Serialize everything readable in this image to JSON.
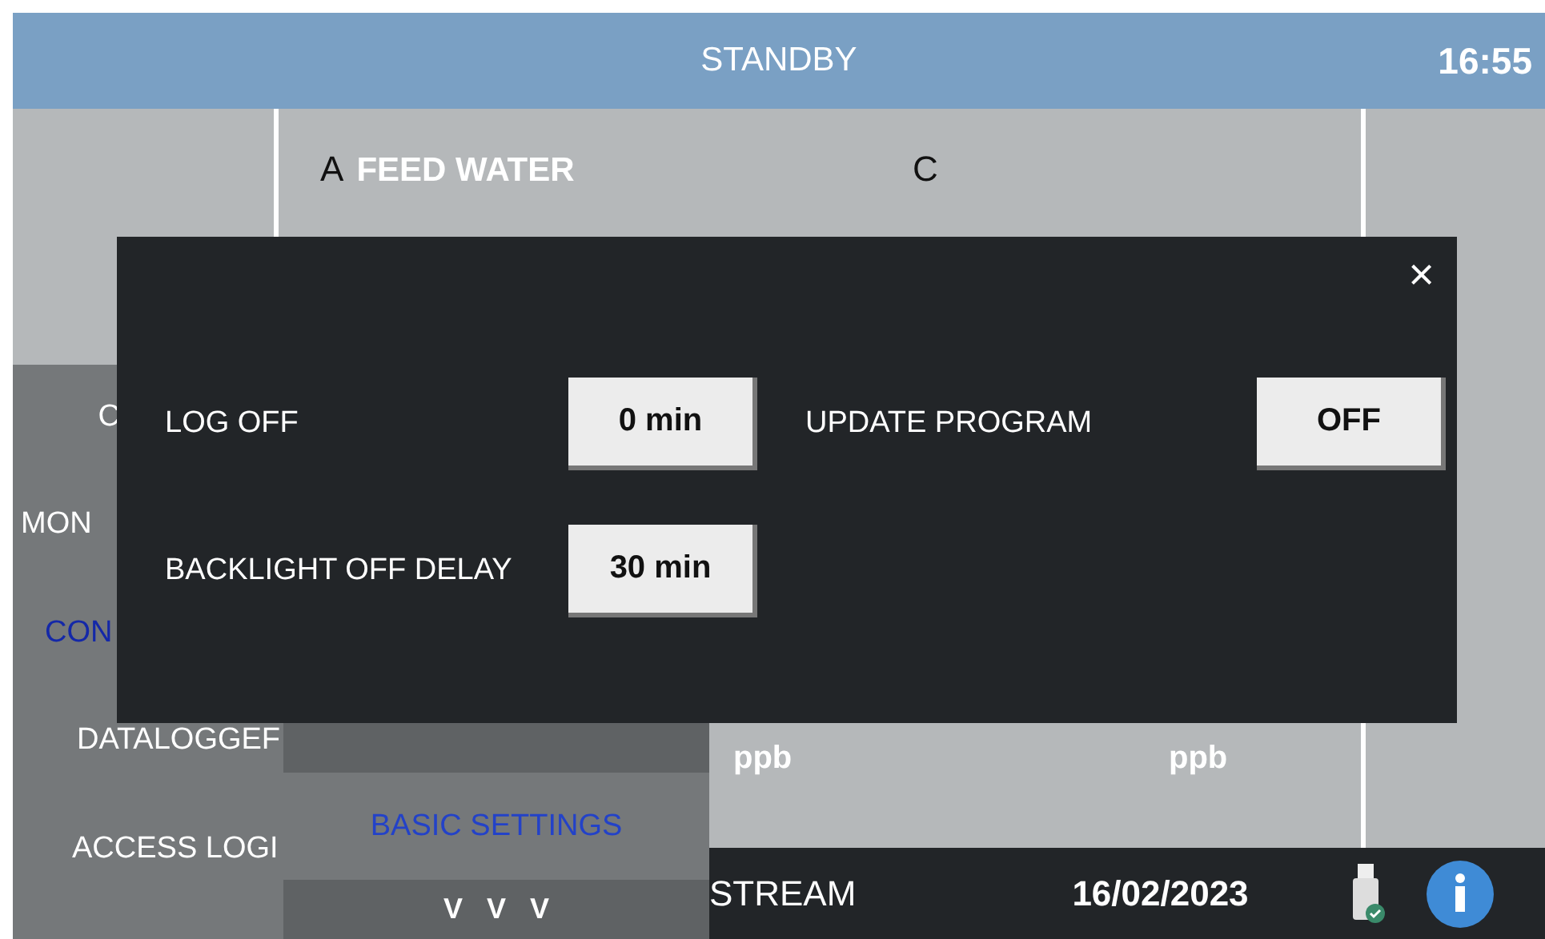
{
  "header": {
    "title": "STANDBY",
    "time": "16:55"
  },
  "channels": [
    {
      "letter": "A",
      "name": "FEED WATER",
      "unit": "ppb"
    },
    {
      "letter": "C",
      "unit": "ppb"
    }
  ],
  "side_menu": [
    {
      "label": "C",
      "selected": false
    },
    {
      "label": "MON",
      "selected": false
    },
    {
      "label": "CON",
      "selected": true
    },
    {
      "label": "DATALOGGEF",
      "selected": false
    },
    {
      "label": "ACCESS LOGI",
      "selected": false
    }
  ],
  "submenu": [
    {
      "label": "BASIC SETTINGS",
      "selected": true,
      "kind": "item"
    },
    {
      "label": "V V V",
      "selected": false,
      "kind": "more"
    }
  ],
  "dialog": {
    "close": "×",
    "settings": [
      {
        "label": "LOG OFF",
        "value": "0 min"
      },
      {
        "label": "UPDATE PROGRAM",
        "value": "OFF"
      },
      {
        "label": "BACKLIGHT OFF DELAY",
        "value": "30 min"
      }
    ]
  },
  "footer": {
    "stream": "STREAM",
    "date": "16/02/2023"
  }
}
